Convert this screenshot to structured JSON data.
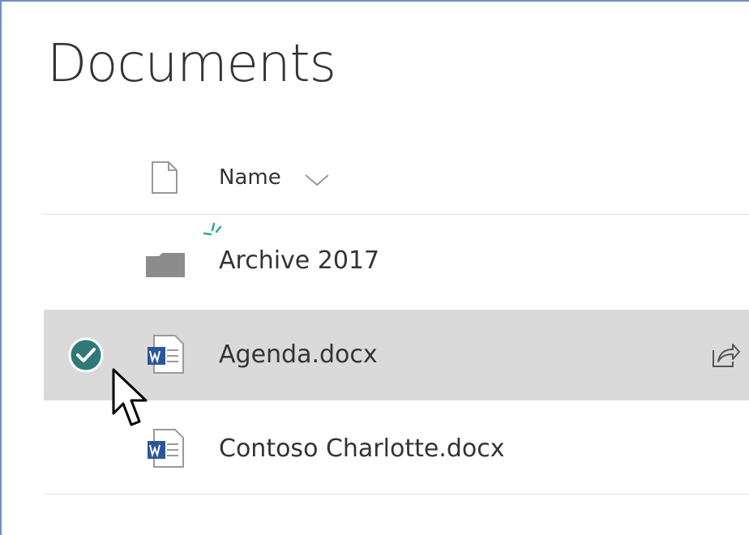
{
  "page": {
    "title": "Documents"
  },
  "list": {
    "header": {
      "name_label": "Name",
      "icon": "file-icon",
      "sort_icon": "chevron-down-icon"
    },
    "items": [
      {
        "label": "Archive 2017",
        "icon": "folder-icon",
        "is_new": true,
        "selected": false
      },
      {
        "label": "Agenda.docx",
        "icon": "word-doc-icon",
        "is_new": false,
        "selected": true
      },
      {
        "label": "Contoso Charlotte.docx",
        "icon": "word-doc-icon",
        "is_new": false,
        "selected": false
      }
    ]
  },
  "colors": {
    "frame_border": "#6d8fc7",
    "selection_bg": "#dadada",
    "check_teal": "#2f7a78",
    "new_indicator": "#2aa79b",
    "word_blue": "#2b579a",
    "folder_gray": "#8c8c8c"
  }
}
